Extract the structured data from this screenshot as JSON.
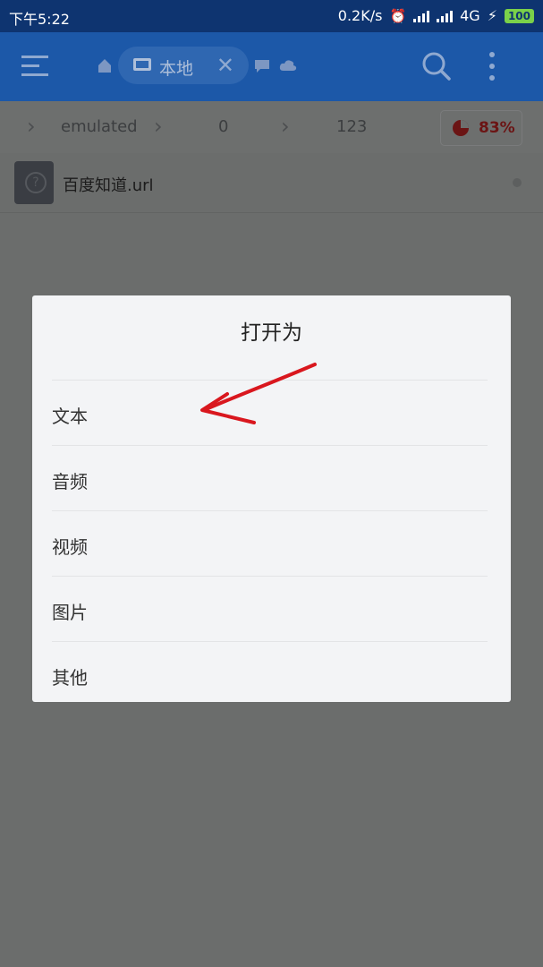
{
  "status_bar": {
    "time": "下午5:22",
    "net_speed": "0.2K/s",
    "network": "4G",
    "battery": "100"
  },
  "toolbar": {
    "active_tab": "本地"
  },
  "path": {
    "crumbs": [
      "emulated",
      "0",
      "123"
    ],
    "storage_percent": "83%"
  },
  "file": {
    "name": "百度知道.url"
  },
  "dialog": {
    "title": "打开为",
    "options": [
      "文本",
      "音频",
      "视频",
      "图片",
      "其他"
    ]
  },
  "colors": {
    "toolbar": "#1c58a8",
    "status_bar": "#0e3470",
    "overlay": "#6b6d6c",
    "dialog_bg": "#f3f4f6",
    "annotation": "#d9171e"
  }
}
